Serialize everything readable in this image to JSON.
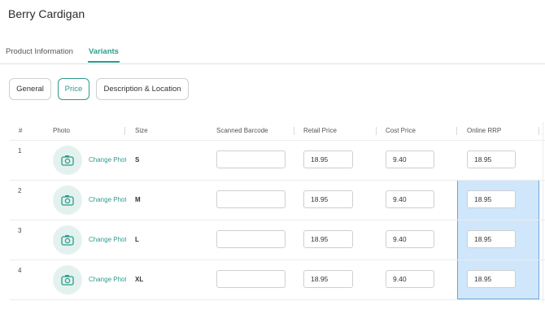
{
  "page": {
    "title": "Berry Cardigan"
  },
  "tabs": [
    {
      "label": "Product Information",
      "active": false
    },
    {
      "label": "Variants",
      "active": true
    }
  ],
  "subtabs": [
    {
      "label": "General",
      "active": false
    },
    {
      "label": "Price",
      "active": true
    },
    {
      "label": "Description & Location",
      "active": false
    }
  ],
  "table": {
    "headers": {
      "num": "#",
      "photo": "Photo",
      "size": "Size",
      "barcode": "Scanned Barcode",
      "retail": "Retail Price",
      "cost": "Cost Price",
      "rrp": "Online RRP"
    },
    "rows": [
      {
        "num": "1",
        "change_photo": "Change Photo",
        "size": "S",
        "barcode": "",
        "retail": "18.95",
        "cost": "9.40",
        "rrp": "18.95"
      },
      {
        "num": "2",
        "change_photo": "Change Photo",
        "size": "M",
        "barcode": "",
        "retail": "18.95",
        "cost": "9.40",
        "rrp": "18.95"
      },
      {
        "num": "3",
        "change_photo": "Change Photo",
        "size": "L",
        "barcode": "",
        "retail": "18.95",
        "cost": "9.40",
        "rrp": "18.95"
      },
      {
        "num": "4",
        "change_photo": "Change Photo",
        "size": "XL",
        "barcode": "",
        "retail": "18.95",
        "cost": "9.40",
        "rrp": "18.95"
      }
    ]
  },
  "colors": {
    "accent": "#2d9c8c",
    "selection": "#cfe6fb",
    "camera_bg": "#e3f2ee"
  },
  "icons": {
    "photo": "camera-icon"
  }
}
